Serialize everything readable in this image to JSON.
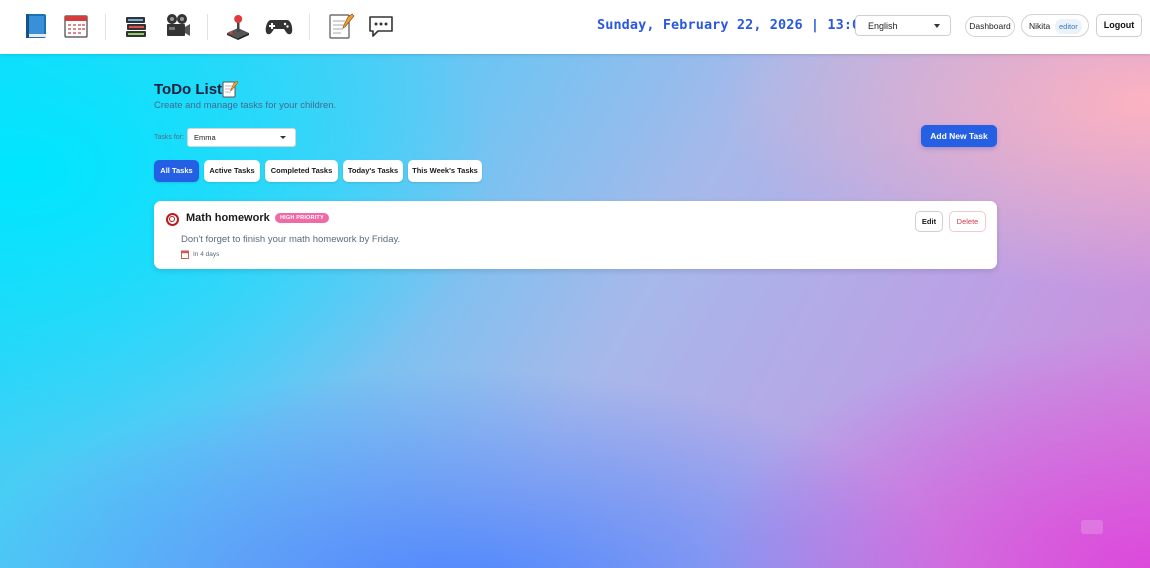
{
  "header": {
    "nav_icons": [
      "book-icon",
      "calendar-icon",
      "books-stack-icon",
      "film-camera-icon",
      "joystick-icon",
      "gamepad-icon",
      "notepad-icon",
      "chat-bubble-icon"
    ],
    "datetime": "Sunday, February 22, 2026 | 13:06:18",
    "language_selected": "English",
    "dashboard_label": "Dashboard",
    "user_name": "Nikita",
    "user_role": "editor",
    "logout_label": "Logout"
  },
  "main": {
    "title": "ToDo List",
    "title_icon": "memo-icon",
    "subtitle": "Create and manage tasks for your children.",
    "tasks_for_label": "Tasks for:",
    "child_selected": "Emma",
    "add_task_label": "Add New Task",
    "filters": [
      {
        "label": "All Tasks",
        "active": true
      },
      {
        "label": "Active Tasks",
        "active": false
      },
      {
        "label": "Completed Tasks",
        "active": false
      },
      {
        "label": "Today's Tasks",
        "active": false
      },
      {
        "label": "This Week's Tasks",
        "active": false
      }
    ],
    "tasks": [
      {
        "title": "Math homework",
        "priority": "HIGH PRIORITY",
        "description": "Don't forget to finish your math homework by Friday.",
        "due": "In 4 days",
        "edit_label": "Edit",
        "delete_label": "Delete"
      }
    ]
  },
  "colors": {
    "accent": "#2560e4",
    "datetime": "#2a57e0",
    "priority_high": "#f06ba6",
    "delete": "#d93b4f"
  }
}
